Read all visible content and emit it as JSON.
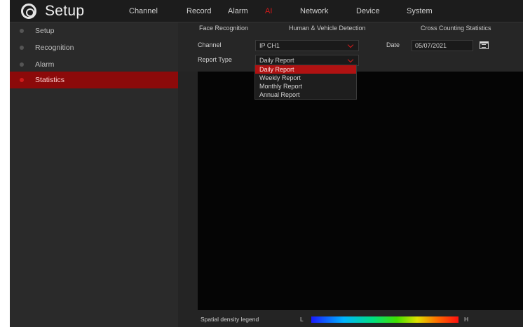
{
  "app": {
    "title": "Setup"
  },
  "menu": [
    {
      "label": "Channel",
      "active": false
    },
    {
      "label": "Record",
      "active": false
    },
    {
      "label": "Alarm",
      "active": false
    },
    {
      "label": "AI",
      "active": true
    },
    {
      "label": "Network",
      "active": false
    },
    {
      "label": "Device",
      "active": false
    },
    {
      "label": "System",
      "active": false
    }
  ],
  "sidebar": {
    "items": [
      {
        "label": "Setup",
        "active": false
      },
      {
        "label": "Recognition",
        "active": false
      },
      {
        "label": "Alarm",
        "active": false
      },
      {
        "label": "Statistics",
        "active": true
      }
    ]
  },
  "subtabs": [
    {
      "label": "Face Recognition"
    },
    {
      "label": "Human & Vehicle Detection"
    },
    {
      "label": "Cross Counting Statistics"
    }
  ],
  "form": {
    "channel_label": "Channel",
    "channel_value": "IP CH1",
    "date_label": "Date",
    "date_value": "05/07/2021",
    "report_type_label": "Report Type",
    "report_type_value": "Daily Report"
  },
  "dropdown": {
    "options": [
      {
        "label": "Daily Report",
        "selected": true
      },
      {
        "label": "Weekly Report",
        "selected": false
      },
      {
        "label": "Monthly Report",
        "selected": false
      },
      {
        "label": "Annual Report",
        "selected": false
      }
    ]
  },
  "legend": {
    "label": "Spatial density legend",
    "low": "L",
    "high": "H"
  },
  "icons": {
    "brand": "gear-icon",
    "calendar": "calendar-icon",
    "dropdown_arrow": "chevron-down-icon"
  },
  "colors": {
    "accent": "#d11a1a",
    "active_sidebar": "#8c0a0a"
  }
}
